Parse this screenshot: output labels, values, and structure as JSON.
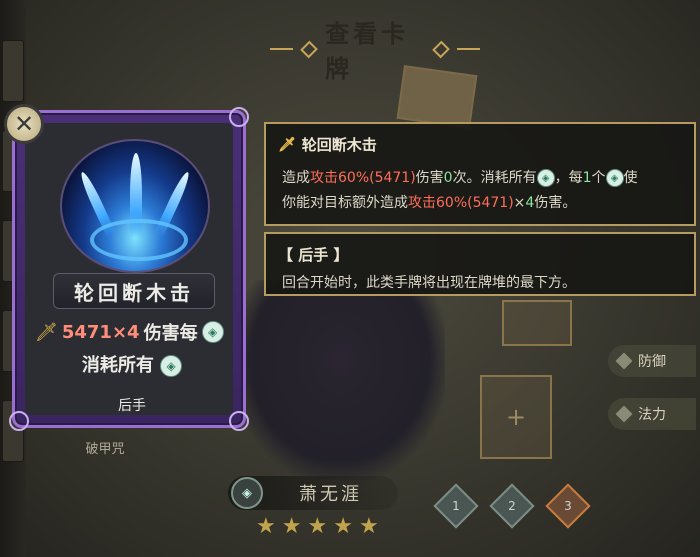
{
  "screen": {
    "title": "查看卡牌"
  },
  "card": {
    "name": "轮回断木击",
    "damage_value": "5471×4",
    "damage_text": "伤害每",
    "cost_text": "消耗所有",
    "tag": "后手"
  },
  "detail": {
    "title": "轮回断木击",
    "line1": {
      "prefix": "造成",
      "attack": "攻击60%(5471)",
      "mid": "伤害",
      "count": "0",
      "suffix": "次。消耗所有",
      "each": "，每",
      "one": "1",
      "unit": "个",
      "use": "使"
    },
    "line2": {
      "prefix": "你能对目标额外造成",
      "attack": "攻击60%(5471)",
      "times": "×",
      "four": "4",
      "suffix": "伤害。"
    }
  },
  "keyword": {
    "title": "【 后手 】",
    "desc": "回合开始时，此类手牌将出现在牌堆的最下方。"
  },
  "background": {
    "character_name": "萧无涯",
    "skill_label": "破甲咒",
    "side_buttons": [
      "防御",
      "法力"
    ],
    "tier_buttons": [
      "1",
      "2",
      "3"
    ],
    "stars": 5
  }
}
